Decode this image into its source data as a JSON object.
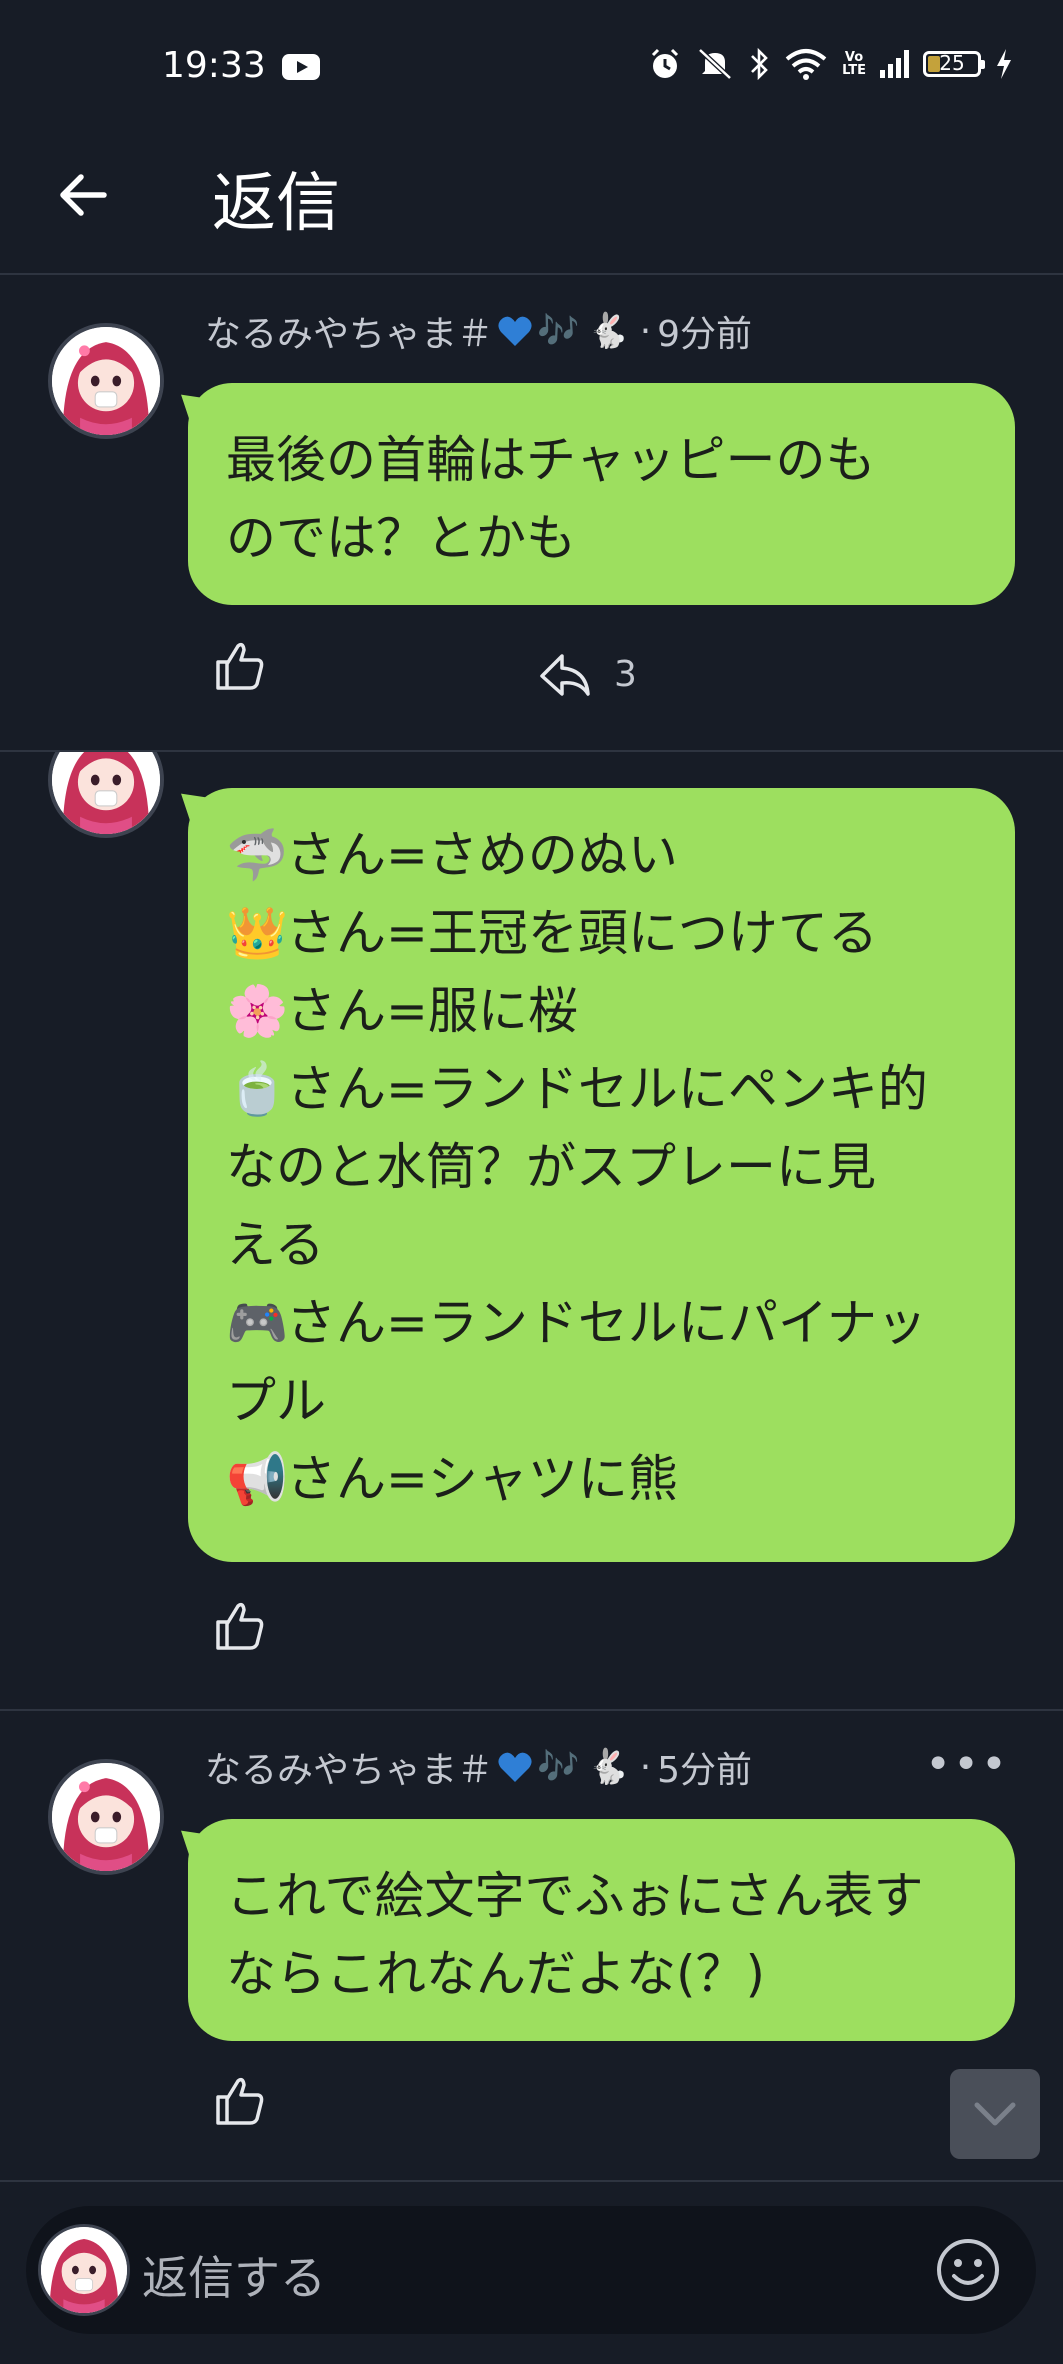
{
  "status_bar": {
    "time": "19:33",
    "battery": "25",
    "icons": [
      "youtube-icon",
      "alarm-icon",
      "mute-icon",
      "bluetooth-icon",
      "wifi-icon",
      "volte-icon",
      "signal-icon",
      "battery-icon",
      "charging-icon"
    ],
    "volte_top": "Vo",
    "volte_bottom": "LTE"
  },
  "header": {
    "title": "返信"
  },
  "comments": [
    {
      "author": "なるみやちゃま＃",
      "notes": "🎶",
      "rabbit": "🐇",
      "separator": "·",
      "time": "9分前",
      "lines": [
        "最後の首輪はチャッピーのも",
        "のでは？とかも"
      ],
      "reply_count": "3"
    },
    {
      "lines": [
        {
          "emoji": "🦈",
          "text": "さん=さめのぬい"
        },
        {
          "emoji": "👑",
          "text": "さん=王冠を頭につけてる"
        },
        {
          "emoji": "🌸",
          "text": "さん=服に桜"
        },
        {
          "emoji": "🍵",
          "text": "さん=ランドセルにペンキ的"
        },
        {
          "emoji": "",
          "text": "なのと水筒？がスプレーに見"
        },
        {
          "emoji": "",
          "text": "える"
        },
        {
          "emoji": "🎮",
          "text": "さん=ランドセルにパイナッ"
        },
        {
          "emoji": "",
          "text": "プル"
        },
        {
          "emoji": "📢",
          "text": "さん=シャツに熊"
        }
      ]
    },
    {
      "author": "なるみやちゃま＃",
      "notes": "🎶",
      "rabbit": "🐇",
      "separator": "·",
      "time": "5分前",
      "more": "•••",
      "lines": [
        "これで絵文字でふぉにさん表す",
        "ならこれなんだよな(？)"
      ]
    }
  ],
  "reply_bar": {
    "placeholder": "返信する"
  },
  "colors": {
    "background": "#171c26",
    "bubble": "#9ddf5f",
    "heart": "#2f7fd6",
    "avatar_hair": "#c8325a"
  }
}
